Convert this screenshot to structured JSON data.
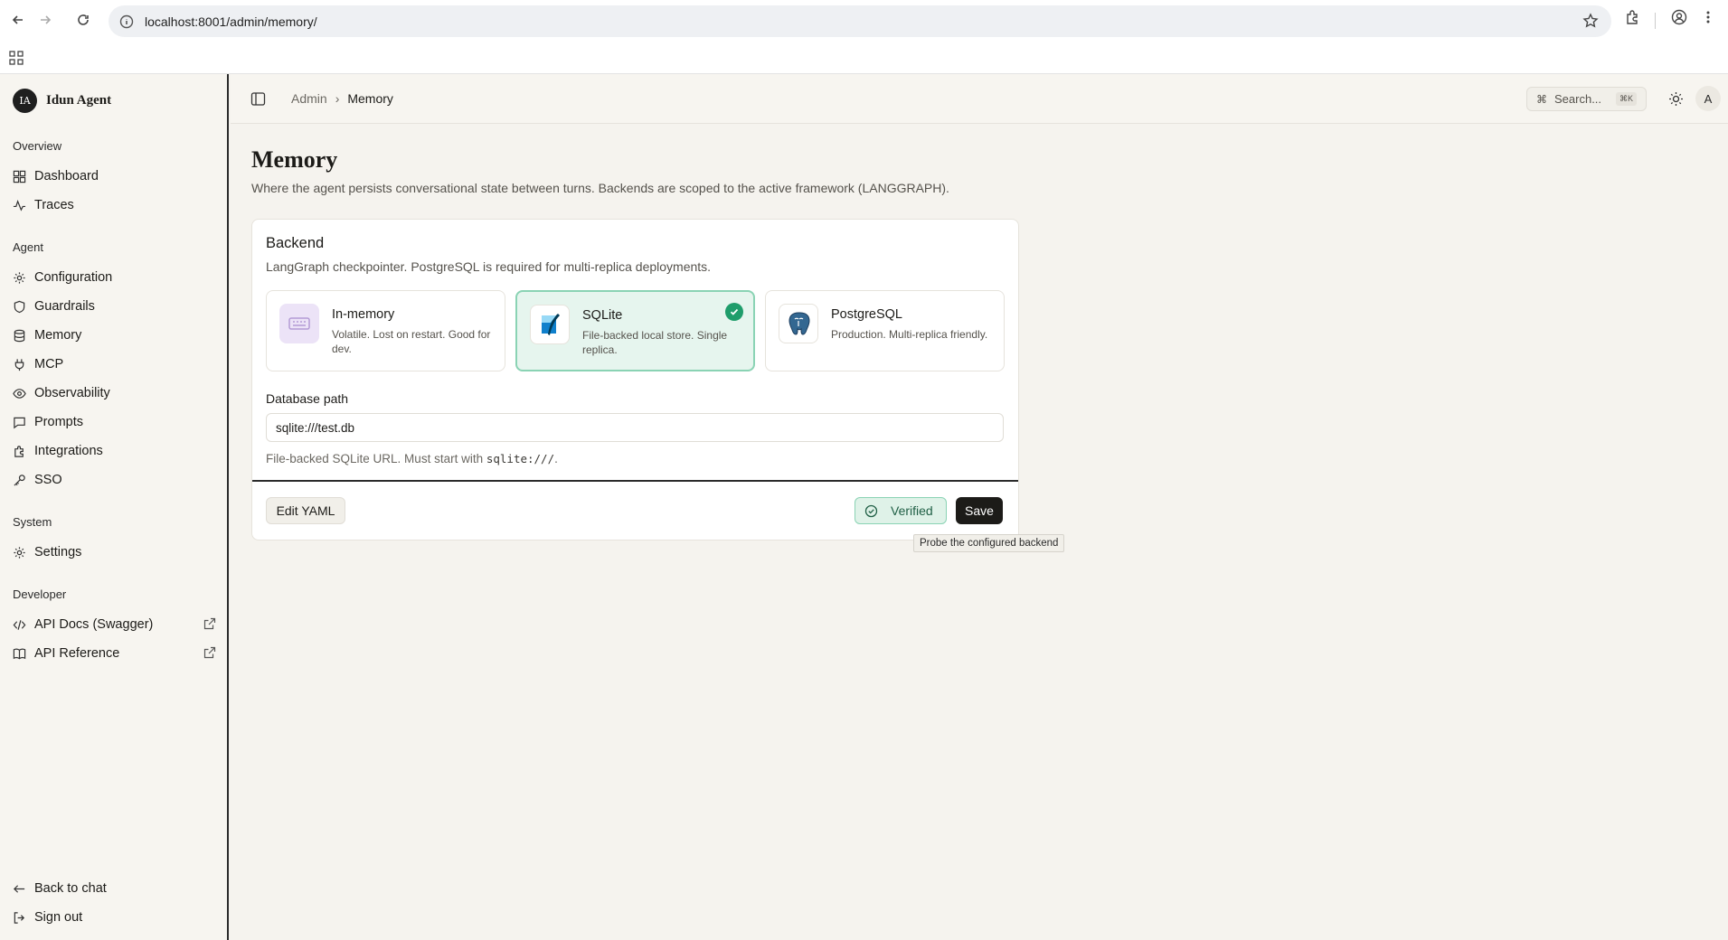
{
  "browser": {
    "url": "localhost:8001/admin/memory/"
  },
  "brand": {
    "initials": "IA",
    "name": "Idun Agent"
  },
  "sidebar": {
    "sections": [
      {
        "label": "Overview",
        "items": [
          {
            "label": "Dashboard",
            "icon": "dashboard-icon"
          },
          {
            "label": "Traces",
            "icon": "activity-icon"
          }
        ]
      },
      {
        "label": "Agent",
        "items": [
          {
            "label": "Configuration",
            "icon": "gear-icon"
          },
          {
            "label": "Guardrails",
            "icon": "shield-icon"
          },
          {
            "label": "Memory",
            "icon": "database-icon"
          },
          {
            "label": "MCP",
            "icon": "plug-icon"
          },
          {
            "label": "Observability",
            "icon": "eye-icon"
          },
          {
            "label": "Prompts",
            "icon": "message-icon"
          },
          {
            "label": "Integrations",
            "icon": "puzzle-icon"
          },
          {
            "label": "SSO",
            "icon": "key-icon"
          }
        ]
      },
      {
        "label": "System",
        "items": [
          {
            "label": "Settings",
            "icon": "gear-icon"
          }
        ]
      },
      {
        "label": "Developer",
        "items": [
          {
            "label": "API Docs (Swagger)",
            "icon": "code-icon"
          },
          {
            "label": "API Reference",
            "icon": "book-icon"
          }
        ]
      }
    ],
    "footer": {
      "back_to_chat": "Back to chat",
      "sign_out": "Sign out"
    }
  },
  "topbar": {
    "breadcrumb": {
      "parent": "Admin",
      "current": "Memory"
    },
    "search_label": "Search...",
    "search_shortcut": "⌘K",
    "user_initial": "A"
  },
  "page": {
    "title": "Memory",
    "description": "Where the agent persists conversational state between turns. Backends are scoped to the active framework (LANGGRAPH)."
  },
  "backend_card": {
    "title": "Backend",
    "description": "LangGraph checkpointer. PostgreSQL is required for multi-replica deployments.",
    "options": [
      {
        "title": "In-memory",
        "description": "Volatile. Lost on restart. Good for dev.",
        "icon": "memory-chip-icon",
        "selected": false
      },
      {
        "title": "SQLite",
        "description": "File-backed local store. Single replica.",
        "icon": "sqlite-logo-icon",
        "selected": true
      },
      {
        "title": "PostgreSQL",
        "description": "Production. Multi-replica friendly.",
        "icon": "postgresql-logo-icon",
        "selected": false
      }
    ],
    "db_path_label": "Database path",
    "db_path_value": "sqlite:///test.db",
    "help_prefix": "File-backed SQLite URL. Must start with ",
    "help_code": "sqlite:///",
    "help_suffix": ".",
    "edit_yaml_label": "Edit YAML",
    "verified_label": "Verified",
    "save_label": "Save",
    "tooltip": "Probe the configured backend"
  },
  "colors": {
    "accent_green": "#1f9d6b",
    "selected_bg": "#e6f5ee",
    "page_bg": "#f5f3ee"
  }
}
